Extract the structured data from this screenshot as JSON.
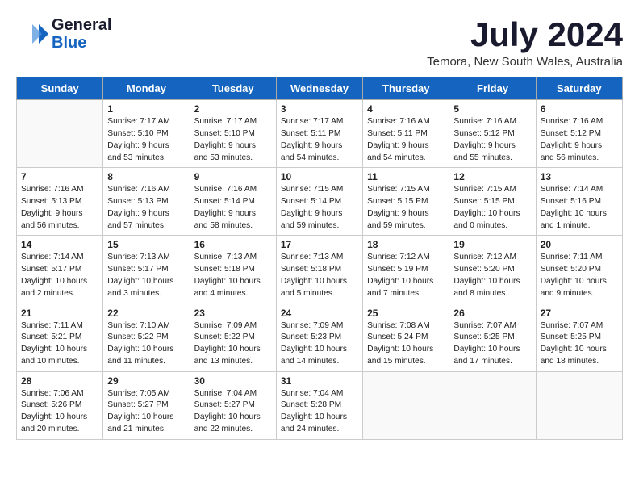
{
  "header": {
    "logo_general": "General",
    "logo_blue": "Blue",
    "month": "July 2024",
    "location": "Temora, New South Wales, Australia"
  },
  "weekdays": [
    "Sunday",
    "Monday",
    "Tuesday",
    "Wednesday",
    "Thursday",
    "Friday",
    "Saturday"
  ],
  "weeks": [
    [
      {
        "day": "",
        "info": ""
      },
      {
        "day": "1",
        "info": "Sunrise: 7:17 AM\nSunset: 5:10 PM\nDaylight: 9 hours\nand 53 minutes."
      },
      {
        "day": "2",
        "info": "Sunrise: 7:17 AM\nSunset: 5:10 PM\nDaylight: 9 hours\nand 53 minutes."
      },
      {
        "day": "3",
        "info": "Sunrise: 7:17 AM\nSunset: 5:11 PM\nDaylight: 9 hours\nand 54 minutes."
      },
      {
        "day": "4",
        "info": "Sunrise: 7:16 AM\nSunset: 5:11 PM\nDaylight: 9 hours\nand 54 minutes."
      },
      {
        "day": "5",
        "info": "Sunrise: 7:16 AM\nSunset: 5:12 PM\nDaylight: 9 hours\nand 55 minutes."
      },
      {
        "day": "6",
        "info": "Sunrise: 7:16 AM\nSunset: 5:12 PM\nDaylight: 9 hours\nand 56 minutes."
      }
    ],
    [
      {
        "day": "7",
        "info": "Sunrise: 7:16 AM\nSunset: 5:13 PM\nDaylight: 9 hours\nand 56 minutes."
      },
      {
        "day": "8",
        "info": "Sunrise: 7:16 AM\nSunset: 5:13 PM\nDaylight: 9 hours\nand 57 minutes."
      },
      {
        "day": "9",
        "info": "Sunrise: 7:16 AM\nSunset: 5:14 PM\nDaylight: 9 hours\nand 58 minutes."
      },
      {
        "day": "10",
        "info": "Sunrise: 7:15 AM\nSunset: 5:14 PM\nDaylight: 9 hours\nand 59 minutes."
      },
      {
        "day": "11",
        "info": "Sunrise: 7:15 AM\nSunset: 5:15 PM\nDaylight: 9 hours\nand 59 minutes."
      },
      {
        "day": "12",
        "info": "Sunrise: 7:15 AM\nSunset: 5:15 PM\nDaylight: 10 hours\nand 0 minutes."
      },
      {
        "day": "13",
        "info": "Sunrise: 7:14 AM\nSunset: 5:16 PM\nDaylight: 10 hours\nand 1 minute."
      }
    ],
    [
      {
        "day": "14",
        "info": "Sunrise: 7:14 AM\nSunset: 5:17 PM\nDaylight: 10 hours\nand 2 minutes."
      },
      {
        "day": "15",
        "info": "Sunrise: 7:13 AM\nSunset: 5:17 PM\nDaylight: 10 hours\nand 3 minutes."
      },
      {
        "day": "16",
        "info": "Sunrise: 7:13 AM\nSunset: 5:18 PM\nDaylight: 10 hours\nand 4 minutes."
      },
      {
        "day": "17",
        "info": "Sunrise: 7:13 AM\nSunset: 5:18 PM\nDaylight: 10 hours\nand 5 minutes."
      },
      {
        "day": "18",
        "info": "Sunrise: 7:12 AM\nSunset: 5:19 PM\nDaylight: 10 hours\nand 7 minutes."
      },
      {
        "day": "19",
        "info": "Sunrise: 7:12 AM\nSunset: 5:20 PM\nDaylight: 10 hours\nand 8 minutes."
      },
      {
        "day": "20",
        "info": "Sunrise: 7:11 AM\nSunset: 5:20 PM\nDaylight: 10 hours\nand 9 minutes."
      }
    ],
    [
      {
        "day": "21",
        "info": "Sunrise: 7:11 AM\nSunset: 5:21 PM\nDaylight: 10 hours\nand 10 minutes."
      },
      {
        "day": "22",
        "info": "Sunrise: 7:10 AM\nSunset: 5:22 PM\nDaylight: 10 hours\nand 11 minutes."
      },
      {
        "day": "23",
        "info": "Sunrise: 7:09 AM\nSunset: 5:22 PM\nDaylight: 10 hours\nand 13 minutes."
      },
      {
        "day": "24",
        "info": "Sunrise: 7:09 AM\nSunset: 5:23 PM\nDaylight: 10 hours\nand 14 minutes."
      },
      {
        "day": "25",
        "info": "Sunrise: 7:08 AM\nSunset: 5:24 PM\nDaylight: 10 hours\nand 15 minutes."
      },
      {
        "day": "26",
        "info": "Sunrise: 7:07 AM\nSunset: 5:25 PM\nDaylight: 10 hours\nand 17 minutes."
      },
      {
        "day": "27",
        "info": "Sunrise: 7:07 AM\nSunset: 5:25 PM\nDaylight: 10 hours\nand 18 minutes."
      }
    ],
    [
      {
        "day": "28",
        "info": "Sunrise: 7:06 AM\nSunset: 5:26 PM\nDaylight: 10 hours\nand 20 minutes."
      },
      {
        "day": "29",
        "info": "Sunrise: 7:05 AM\nSunset: 5:27 PM\nDaylight: 10 hours\nand 21 minutes."
      },
      {
        "day": "30",
        "info": "Sunrise: 7:04 AM\nSunset: 5:27 PM\nDaylight: 10 hours\nand 22 minutes."
      },
      {
        "day": "31",
        "info": "Sunrise: 7:04 AM\nSunset: 5:28 PM\nDaylight: 10 hours\nand 24 minutes."
      },
      {
        "day": "",
        "info": ""
      },
      {
        "day": "",
        "info": ""
      },
      {
        "day": "",
        "info": ""
      }
    ]
  ]
}
